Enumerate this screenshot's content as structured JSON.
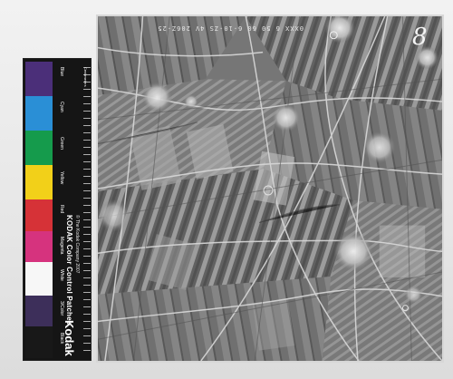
{
  "photo": {
    "edge_text": "0XXX 6 50 60 6-10-ZS 4V 206Z-25 80",
    "frame_number": "8"
  },
  "color_card": {
    "title": "KODAK Color Control Patches",
    "subtitle": "© The Kodak Company 2007",
    "brand": "Kodak",
    "scale_label": "Centimeters",
    "labels": [
      "Blue",
      "Cyan",
      "Green",
      "Yellow",
      "Red",
      "Magenta",
      "White",
      "3/Color",
      "Black"
    ]
  }
}
